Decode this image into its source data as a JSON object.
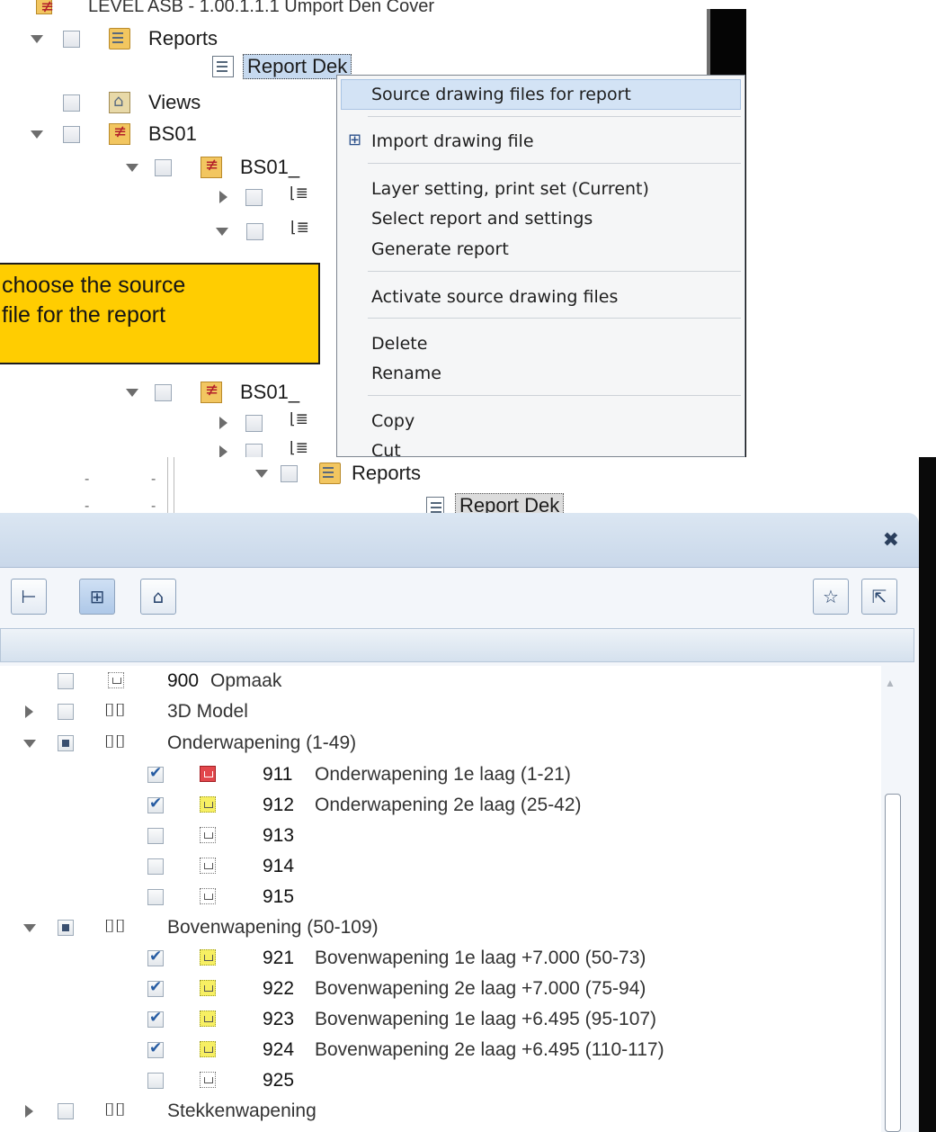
{
  "top_tree": {
    "cut_header": "LEVEL ASB - 1.00.1.1.1 Umport Den Cover",
    "reports_label": "Reports",
    "report_item": "Report Dek",
    "views_label": "Views",
    "bs01_label": "BS01",
    "bs01_child1": "BS01_",
    "bs01_child2": "BS01_",
    "reports2_label": "Reports",
    "report2_item": "Report Dek"
  },
  "context_menu": {
    "items": [
      "Source drawing files for report",
      "Import drawing file",
      "Layer setting, print set (Current)",
      "Select report and settings",
      "Generate report",
      "Activate source drawing files",
      "Delete",
      "Rename",
      "Copy",
      "Cut"
    ]
  },
  "callout": {
    "line1": "choose the source",
    "line2": "file for the report"
  },
  "mid_rows": [
    "-",
    "-",
    "-",
    "-"
  ],
  "panel": {
    "close_icon": "close-icon",
    "toolbar_left": [
      "tree-structure-icon",
      "derived-structure-icon",
      "house-structure-icon"
    ],
    "toolbar_right": [
      "favorite-folder-icon",
      "export-icon"
    ]
  },
  "layer_tree": {
    "rows": [
      {
        "num": "900",
        "name": "Opmaak"
      },
      {
        "group": "3D Model"
      },
      {
        "group": "Onderwapening (1-49)"
      },
      {
        "num": "911",
        "name": "Onderwapening 1e laag (1-21)"
      },
      {
        "num": "912",
        "name": "Onderwapening 2e laag (25-42)"
      },
      {
        "num": "913",
        "name": ""
      },
      {
        "num": "914",
        "name": ""
      },
      {
        "num": "915",
        "name": ""
      },
      {
        "group": "Bovenwapening (50-109)"
      },
      {
        "num": "921",
        "name": "Bovenwapening 1e laag +7.000 (50-73)"
      },
      {
        "num": "922",
        "name": "Bovenwapening 2e laag +7.000 (75-94)"
      },
      {
        "num": "923",
        "name": "Bovenwapening 1e laag +6.495 (95-107)"
      },
      {
        "num": "924",
        "name": "Bovenwapening 2e laag +6.495 (110-117)"
      },
      {
        "num": "925",
        "name": ""
      },
      {
        "group": "Stekkenwapening"
      }
    ]
  },
  "colors": {
    "highlight": "#d3e3f5",
    "callout": "#ffcd01",
    "layer_red": "#e2474c",
    "layer_yellow": "#f7ef63"
  }
}
